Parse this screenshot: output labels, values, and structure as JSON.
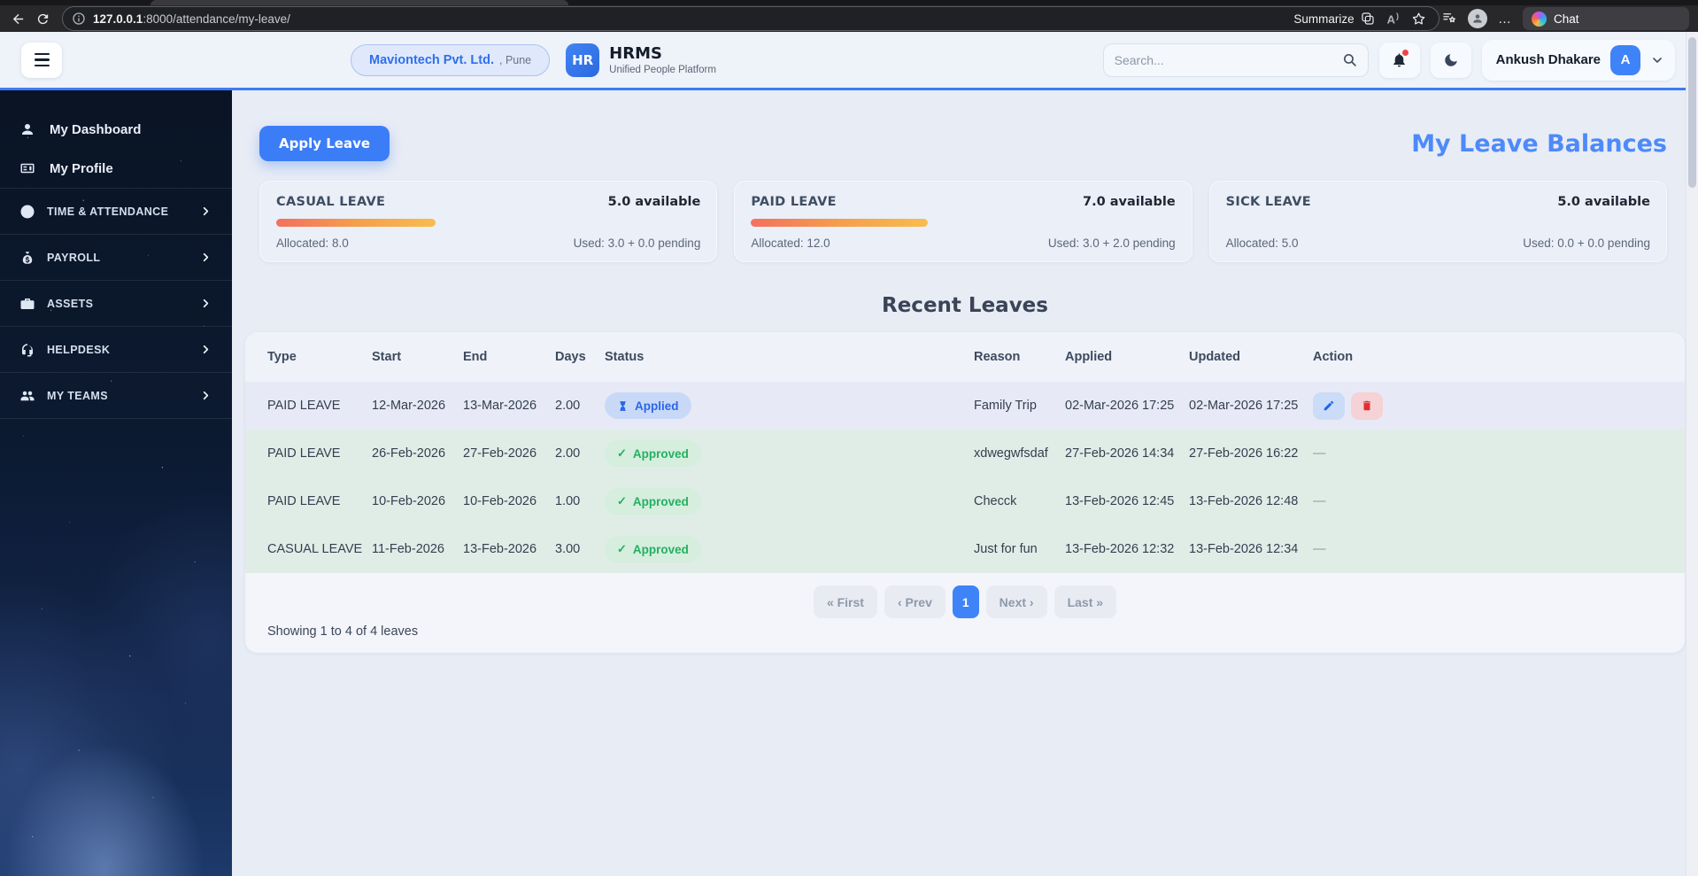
{
  "browser": {
    "url_host": "127.0.0.1",
    "url_path": ":8000/attendance/my-leave/",
    "summarize_label": "Summarize",
    "read_aloud_label": "A",
    "more_label": "…",
    "chat_label": "Chat"
  },
  "header": {
    "company_name": "Maviontech Pvt. Ltd.",
    "company_city": ", Pune",
    "logo_text": "HR",
    "app_name": "HRMS",
    "app_tagline": "Unified People Platform",
    "search_placeholder": "Search...",
    "user_name": "Ankush Dhakare",
    "user_initial": "A"
  },
  "sidebar": {
    "items": [
      {
        "label": "My Dashboard",
        "icon": "user-icon"
      },
      {
        "label": "My Profile",
        "icon": "id-card-icon"
      },
      {
        "label": "TIME & ATTENDANCE",
        "icon": "clock-icon"
      },
      {
        "label": "PAYROLL",
        "icon": "money-bag-icon"
      },
      {
        "label": "ASSETS",
        "icon": "briefcase-icon"
      },
      {
        "label": "HELPDESK",
        "icon": "headset-icon"
      },
      {
        "label": "MY TEAMS",
        "icon": "team-icon"
      }
    ]
  },
  "main": {
    "apply_leave_label": "Apply Leave",
    "balances_title": "My Leave Balances",
    "balance_cards": [
      {
        "type": "CASUAL LEAVE",
        "available": "5.0 available",
        "allocated": "Allocated: 8.0",
        "used": "Used: 3.0 + 0.0 pending",
        "used_pct": 37.5
      },
      {
        "type": "PAID LEAVE",
        "available": "7.0 available",
        "allocated": "Allocated: 12.0",
        "used": "Used: 3.0 + 2.0 pending",
        "used_pct": 41.7
      },
      {
        "type": "SICK LEAVE",
        "available": "5.0 available",
        "allocated": "Allocated: 5.0",
        "used": "Used: 0.0 + 0.0 pending",
        "used_pct": 0
      }
    ],
    "recent_title": "Recent Leaves",
    "table": {
      "headers": [
        "Type",
        "Start",
        "End",
        "Days",
        "Status",
        "Reason",
        "Applied",
        "Updated",
        "Action"
      ],
      "rows": [
        {
          "type": "PAID LEAVE",
          "start": "12-Mar-2026",
          "end": "13-Mar-2026",
          "days": "2.00",
          "status": "Applied",
          "reason": "Family Trip",
          "applied": "02-Mar-2026 17:25",
          "updated": "02-Mar-2026 17:25",
          "action": ""
        },
        {
          "type": "PAID LEAVE",
          "start": "26-Feb-2026",
          "end": "27-Feb-2026",
          "days": "2.00",
          "status": "Approved",
          "reason": "xdwegwfsdaf",
          "applied": "27-Feb-2026 14:34",
          "updated": "27-Feb-2026 16:22",
          "action": "—"
        },
        {
          "type": "PAID LEAVE",
          "start": "10-Feb-2026",
          "end": "10-Feb-2026",
          "days": "1.00",
          "status": "Approved",
          "reason": "Checck",
          "applied": "13-Feb-2026 12:45",
          "updated": "13-Feb-2026 12:48",
          "action": "—"
        },
        {
          "type": "CASUAL LEAVE",
          "start": "11-Feb-2026",
          "end": "13-Feb-2026",
          "days": "3.00",
          "status": "Approved",
          "reason": "Just for fun",
          "applied": "13-Feb-2026 12:32",
          "updated": "13-Feb-2026 12:34",
          "action": "—"
        }
      ]
    },
    "pagination": {
      "first": "« First",
      "prev": "‹ Prev",
      "page": "1",
      "next": "Next ›",
      "last": "Last »"
    },
    "showing_text": "Showing 1 to 4 of 4 leaves"
  },
  "icons": {
    "search": "magnifier",
    "bell": "bell",
    "moon": "crescent",
    "check": "✓",
    "hourglass": "⧖",
    "edit": "pencil",
    "delete": "trash",
    "chevron_right": "›",
    "chevron_down": "⌄",
    "back": "←",
    "refresh": "⟳",
    "info": "ⓘ",
    "star": "☆",
    "ellipsis": "…"
  },
  "colors": {
    "accent_blue": "#3b7df7",
    "title_blue": "#4d8afa",
    "approved_green": "#23b061",
    "applied_blue": "#2a66e8",
    "delete_red": "#e03131",
    "bar_gradient_start": "#f4705f",
    "bar_gradient_end": "#f8bd4e"
  }
}
